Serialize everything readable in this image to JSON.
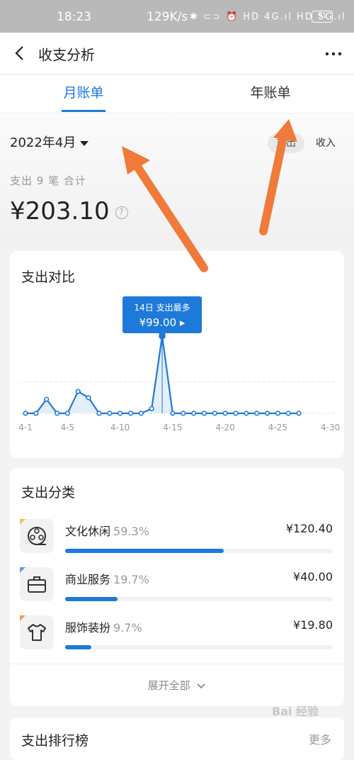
{
  "status_bar": {
    "time": "18:23",
    "net_speed": "129K/s",
    "icons_text": "✱ ⊂⊃ ⏰ HD 4G.ıl HD 5G.ıl",
    "battery": "91"
  },
  "nav": {
    "title": "收支分析",
    "back_icon": "chevron-left-icon",
    "more_icon": "more-dots-icon"
  },
  "tabs": [
    {
      "label": "月账单",
      "active": true
    },
    {
      "label": "年账单",
      "active": false
    }
  ],
  "summary": {
    "month": "2022年4月",
    "toggle_expense": "支出",
    "toggle_income": "收入",
    "count_line": "支出 9 笔 合计",
    "total": "¥203.10",
    "help_icon": "?"
  },
  "chart": {
    "title": "支出对比",
    "tooltip_line1": "14日 支出最多",
    "tooltip_line2": "¥99.00 ▸",
    "accent": "#1d7ad8"
  },
  "chart_data": {
    "type": "line",
    "x": [
      "4-1",
      "4-2",
      "4-3",
      "4-4",
      "4-5",
      "4-6",
      "4-7",
      "4-8",
      "4-9",
      "4-10",
      "4-11",
      "4-12",
      "4-13",
      "4-14",
      "4-15",
      "4-16",
      "4-17",
      "4-18",
      "4-19",
      "4-20",
      "4-21",
      "4-22",
      "4-23",
      "4-24",
      "4-25",
      "4-26",
      "4-27"
    ],
    "values": [
      0,
      0,
      18,
      0,
      0,
      28,
      20,
      0,
      0,
      0,
      0,
      0,
      6,
      99,
      0,
      0,
      0,
      0,
      0,
      0,
      0,
      0,
      0,
      0,
      0,
      0,
      0
    ],
    "tick_labels": [
      "4-1",
      "4-5",
      "4-10",
      "4-15",
      "4-20",
      "4-25",
      "4-30"
    ],
    "highlight": {
      "x": "4-14",
      "value": 99.0
    },
    "grid": true
  },
  "categories_card": {
    "title": "支出分类",
    "items": [
      {
        "name": "文化休闲",
        "pct": "59.3%",
        "amount": "¥120.40",
        "share": 0.593,
        "icon": "film-reel-icon",
        "corner": "#f5c242"
      },
      {
        "name": "商业服务",
        "pct": "19.7%",
        "amount": "¥40.00",
        "share": 0.197,
        "icon": "briefcase-icon",
        "corner": "#5aa0e8"
      },
      {
        "name": "服饰装扮",
        "pct": "9.7%",
        "amount": "¥19.80",
        "share": 0.097,
        "icon": "shirt-icon",
        "corner": "#f09a55"
      }
    ],
    "expand_label": "展开全部"
  },
  "ranking": {
    "title": "支出排行榜",
    "more_label": "更多"
  },
  "watermark": "Bai 经验",
  "annotation_color": "#f07a3a"
}
